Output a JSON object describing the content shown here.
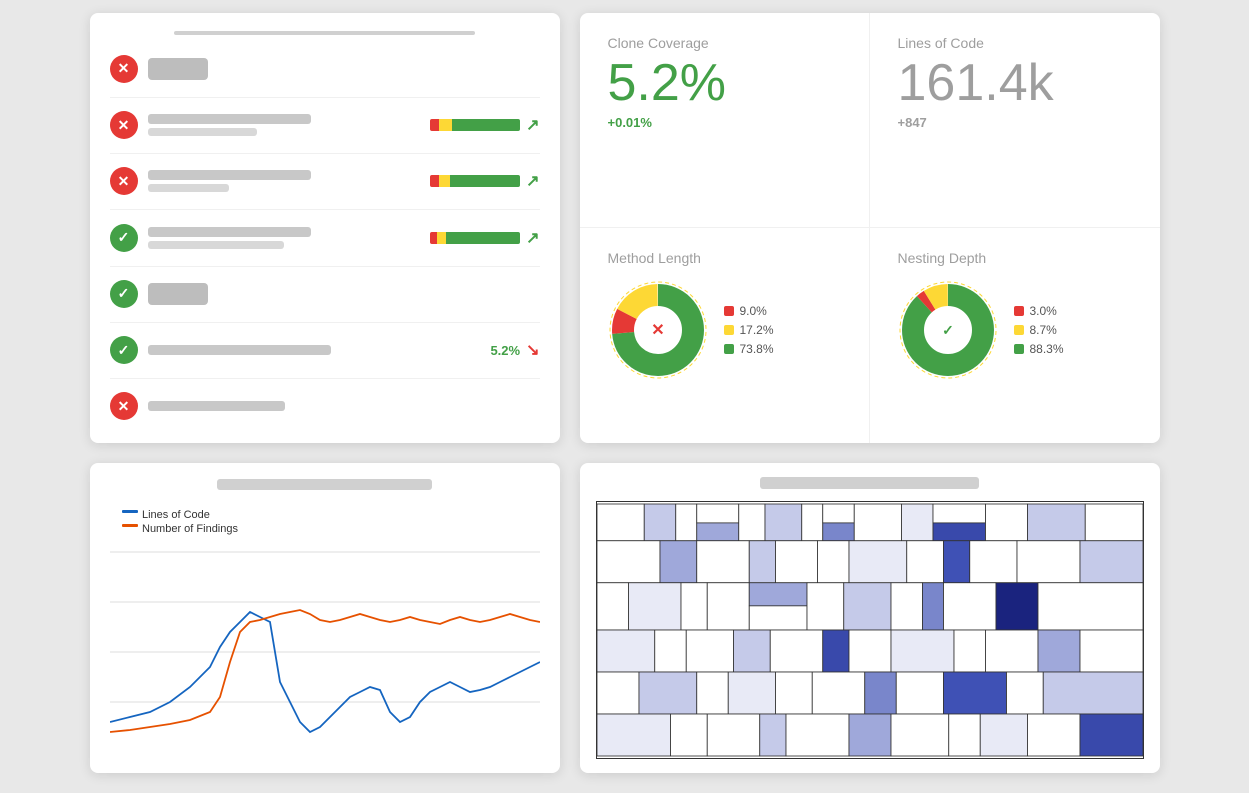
{
  "panels": {
    "list": {
      "header_bar": "header",
      "rows": [
        {
          "status": "red",
          "has_tag": true,
          "has_bar": false,
          "has_arrow": false,
          "bar": null,
          "value": null
        },
        {
          "status": "red",
          "has_tag": false,
          "has_bar": true,
          "has_arrow": true,
          "bar": {
            "red": 8,
            "yellow": 12,
            "green": 60
          },
          "arrow_dir": "up",
          "value": null
        },
        {
          "status": "red",
          "has_tag": false,
          "has_bar": true,
          "has_arrow": true,
          "bar": {
            "red": 8,
            "yellow": 10,
            "green": 60
          },
          "arrow_dir": "up",
          "value": null
        },
        {
          "status": "green",
          "has_tag": false,
          "has_bar": true,
          "has_arrow": true,
          "bar": {
            "red": 6,
            "yellow": 8,
            "green": 65
          },
          "arrow_dir": "up",
          "value": null
        },
        {
          "status": "green",
          "has_tag": true,
          "has_bar": false,
          "has_arrow": false,
          "bar": null,
          "value": null
        },
        {
          "status": "green",
          "has_tag": false,
          "has_bar": false,
          "has_arrow": true,
          "bar": null,
          "arrow_dir": "down",
          "value": "5.2%"
        },
        {
          "status": "red",
          "has_tag": false,
          "has_bar": false,
          "has_arrow": false,
          "bar": null,
          "value": null
        }
      ]
    },
    "metrics": {
      "clone_coverage": {
        "title": "Clone Coverage",
        "value": "5.2%",
        "change": "+0.01%",
        "change_color": "green"
      },
      "lines_of_code": {
        "title": "Lines of Code",
        "value": "161.4k",
        "change": "+847",
        "change_color": "gray"
      },
      "method_length": {
        "title": "Method Length",
        "legend": [
          {
            "color": "#e53935",
            "label": "9.0%"
          },
          {
            "color": "#fdd835",
            "label": "17.2%"
          },
          {
            "color": "#43a047",
            "label": "73.8%"
          }
        ]
      },
      "nesting_depth": {
        "title": "Nesting Depth",
        "legend": [
          {
            "color": "#e53935",
            "label": "3.0%"
          },
          {
            "color": "#fdd835",
            "label": "8.7%"
          },
          {
            "color": "#43a047",
            "label": "88.3%"
          }
        ]
      }
    },
    "line_chart": {
      "legend": [
        {
          "color": "#1565c0",
          "label": "Lines of Code"
        },
        {
          "color": "#e65100",
          "label": "Number of Findings"
        }
      ]
    },
    "treemap": {
      "title": "treemap"
    }
  }
}
